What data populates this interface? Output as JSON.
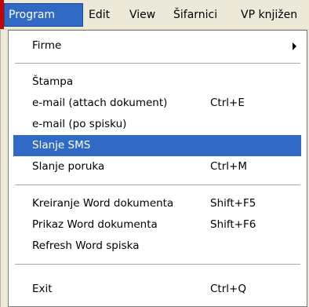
{
  "menubar": {
    "items": [
      "Program",
      "Edit",
      "View",
      "Šifarnici",
      "VP knjižen"
    ]
  },
  "dropdown": {
    "items": [
      {
        "label": "Firme",
        "submenu_arrow": true
      },
      {
        "label": "Štampa"
      },
      {
        "label": "e-mail (attach dokument)",
        "shortcut": "Ctrl+E"
      },
      {
        "label": "e-mail (po spisku)"
      },
      {
        "label": "Slanje SMS",
        "highlighted": true
      },
      {
        "label": "Slanje poruka",
        "shortcut": "Ctrl+M"
      },
      {
        "label": "Kreiranje Word dokumenta",
        "shortcut": "Shift+F5"
      },
      {
        "label": "Prikaz Word dokumenta",
        "shortcut": "Shift+F6"
      },
      {
        "label": "Refresh Word spiska"
      },
      {
        "label": "Exit",
        "shortcut": "Ctrl+Q"
      }
    ]
  },
  "colors": {
    "highlight": "#316ac5",
    "menubar_bg": "#ece9d8",
    "menu_bg": "#ffffff",
    "left_strip": "#c70000"
  }
}
